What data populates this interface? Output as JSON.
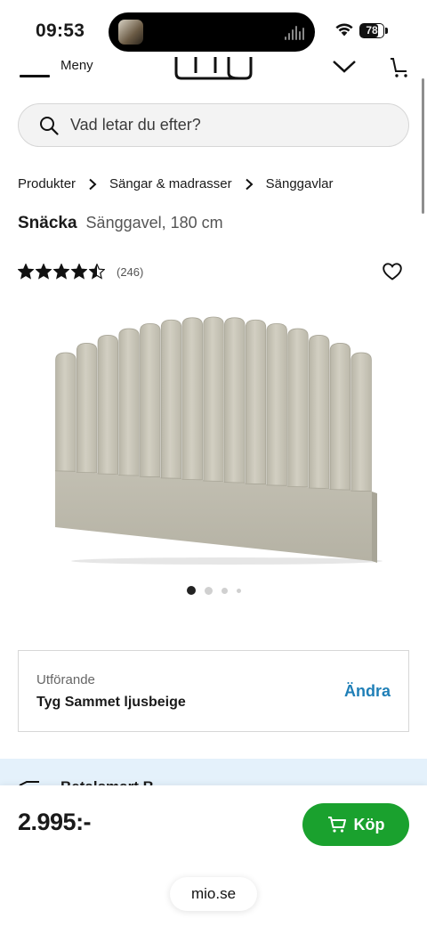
{
  "status_bar": {
    "time": "09:53",
    "battery": "78",
    "battery_level": 0.78
  },
  "header": {
    "menu_label": "Meny"
  },
  "search": {
    "placeholder": "Vad letar du efter?"
  },
  "breadcrumb": [
    "Produkter",
    "Sängar & madrasser",
    "Sänggavlar"
  ],
  "product": {
    "name": "Snäcka",
    "description": "Sänggavel, 180 cm",
    "rating": 4.5,
    "rating_max": 5,
    "review_count": "(246)",
    "image_count": 4,
    "active_image": 1
  },
  "variant": {
    "label": "Utförande",
    "value": "Tyg Sammet ljusbeige",
    "change_label": "Ändra"
  },
  "info_band": {
    "text": "Betalsmart B..."
  },
  "buy_bar": {
    "price": "2.995:-",
    "buy_label": "Köp"
  },
  "browser": {
    "url": "mio.se"
  },
  "colors": {
    "buy_green": "#1aa12e",
    "link_blue": "#1f7fb7",
    "info_band": "#e4f1fb",
    "fabric": "#c9c6b8"
  }
}
